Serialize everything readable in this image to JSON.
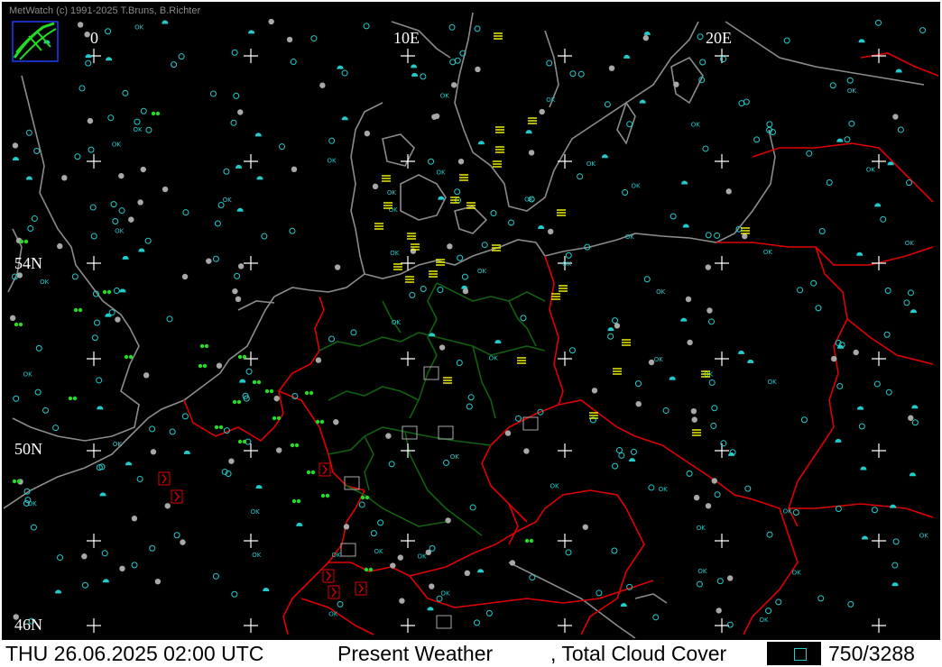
{
  "credit": "MetWatch  (c) 1991-2025 T.Bruns, B.Richter",
  "grid_labels": {
    "lon_0": "0",
    "lon_10": "10E",
    "lon_20": "20E",
    "lat_54": "54N",
    "lat_50": "50N",
    "lat_46": "46N"
  },
  "status": {
    "datetime": "THU 26.06.2025 02:00 UTC",
    "parameter": "Present Weather",
    "secondary": ", Total Cloud Cover",
    "count": "750/3288"
  },
  "colors": {
    "coast": "#8c8c8c",
    "country_border": "#e00000",
    "state_border": "#106010",
    "cloud_symbol": "#22cccc",
    "station_gray": "#a8a8a8",
    "mist_yellow": "#ffff00",
    "rain_green": "#22dd22",
    "thunder_red": "#e00000"
  },
  "symbol_ok": "OK"
}
